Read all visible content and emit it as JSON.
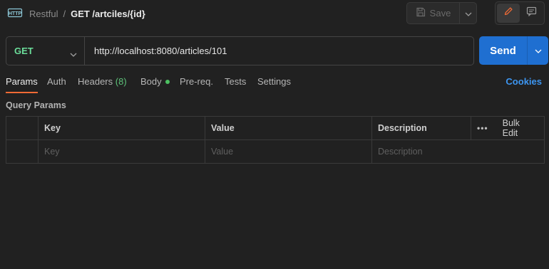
{
  "header": {
    "icon": "http-icon",
    "collection": "Restful",
    "separator": "/",
    "request_name": "GET /artciles/{id}",
    "save_label": "Save"
  },
  "request": {
    "method": "GET",
    "url": "http://localhost:8080/articles/101",
    "send_label": "Send"
  },
  "tabs": [
    {
      "label": "Params",
      "active": true
    },
    {
      "label": "Auth"
    },
    {
      "label": "Headers",
      "count": "(8)"
    },
    {
      "label": "Body",
      "indicator": "green-dot"
    },
    {
      "label": "Pre-req."
    },
    {
      "label": "Tests"
    },
    {
      "label": "Settings"
    }
  ],
  "cookies_label": "Cookies",
  "query_params": {
    "title": "Query Params",
    "columns": {
      "key": "Key",
      "value": "Value",
      "description": "Description"
    },
    "bulk_edit_label": "Bulk Edit",
    "more_label": "•••",
    "placeholders": {
      "key": "Key",
      "value": "Value",
      "description": "Description"
    }
  },
  "colors": {
    "background": "#212121",
    "method_get": "#6bdd9a",
    "send_button": "#1f6fd1",
    "active_tab_underline": "#f06a35",
    "cookies_link": "#3d96f2",
    "headers_count": "#5ec27a"
  }
}
